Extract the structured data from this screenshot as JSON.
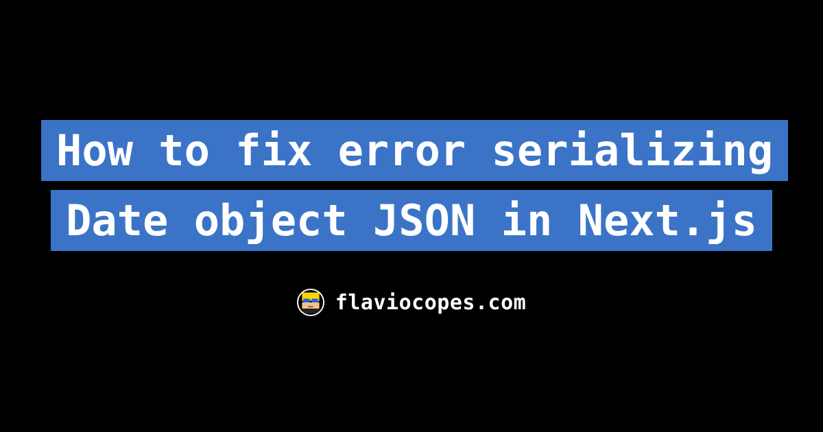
{
  "title": "How to fix error serializing Date object JSON in Next.js",
  "byline": {
    "site": "flaviocopes.com"
  },
  "colors": {
    "accent": "#3b74c7",
    "background": "#000000",
    "text": "#ffffff"
  }
}
